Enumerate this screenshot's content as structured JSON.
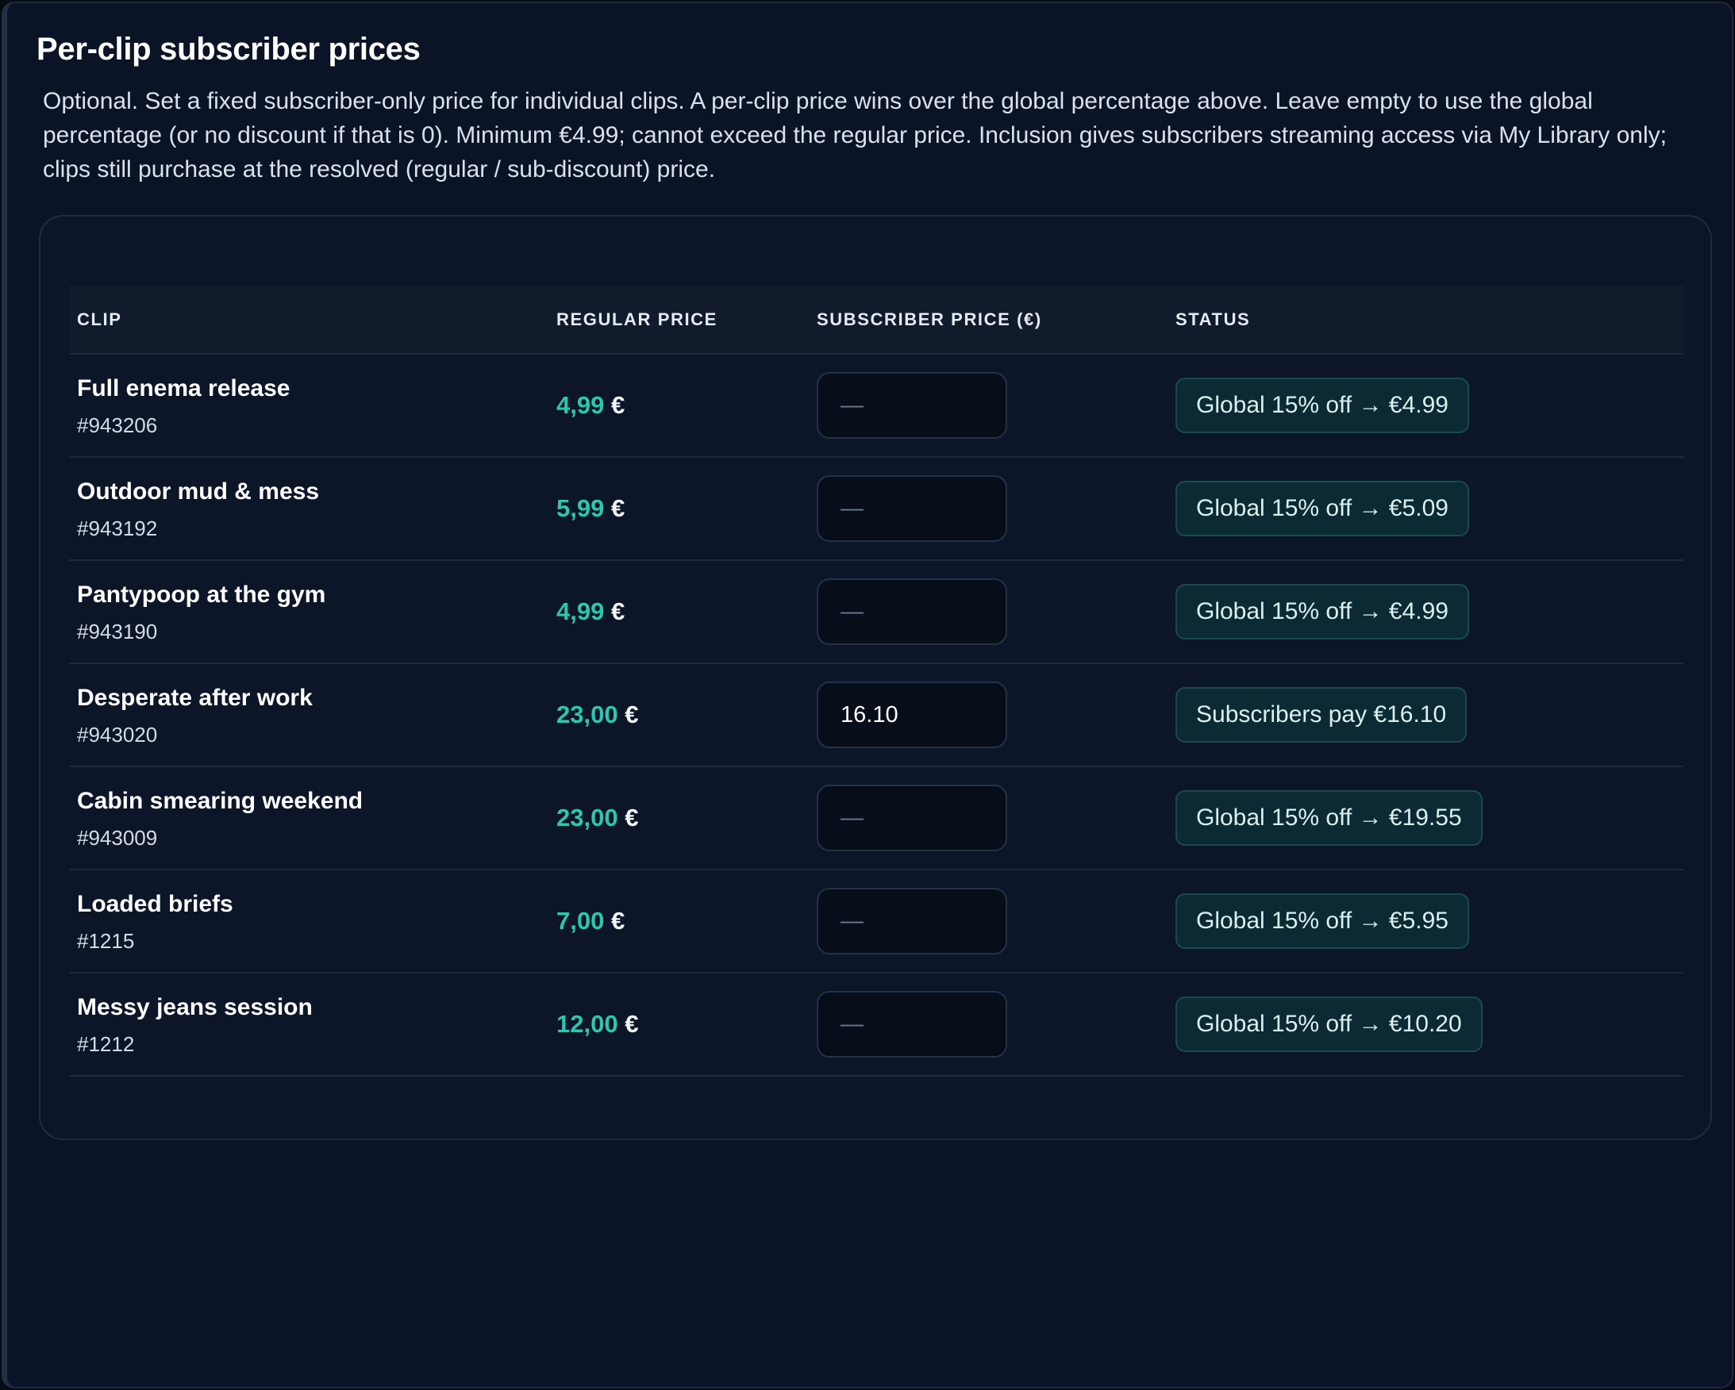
{
  "header": {
    "title": "Per-clip subscriber prices",
    "description": "Optional. Set a fixed subscriber-only price for individual clips. A per-clip price wins over the global percentage above. Leave empty to use the global percentage (or no discount if that is 0). Minimum €4.99; cannot exceed the regular price. Inclusion gives subscribers streaming access via My Library only; clips still purchase at the resolved (regular / sub-discount) price."
  },
  "table": {
    "columns": [
      "CLIP",
      "REGULAR PRICE",
      "SUBSCRIBER PRICE (€)",
      "STATUS"
    ],
    "rows": [
      {
        "name": "Full enema release",
        "id": "#943206",
        "price": "4,99",
        "currency": "€",
        "sub_value": "",
        "sub_placeholder": "—",
        "status": "Global 15% off → €4.99"
      },
      {
        "name": "Outdoor mud & mess",
        "id": "#943192",
        "price": "5,99",
        "currency": "€",
        "sub_value": "",
        "sub_placeholder": "—",
        "status": "Global 15% off → €5.09"
      },
      {
        "name": "Pantypoop at the gym",
        "id": "#943190",
        "price": "4,99",
        "currency": "€",
        "sub_value": "",
        "sub_placeholder": "—",
        "status": "Global 15% off → €4.99"
      },
      {
        "name": "Desperate after work",
        "id": "#943020",
        "price": "23,00",
        "currency": "€",
        "sub_value": "16.10",
        "sub_placeholder": "—",
        "status": "Subscribers pay €16.10"
      },
      {
        "name": "Cabin smearing weekend",
        "id": "#943009",
        "price": "23,00",
        "currency": "€",
        "sub_value": "",
        "sub_placeholder": "—",
        "status": "Global 15% off → €19.55"
      },
      {
        "name": "Loaded briefs",
        "id": "#1215",
        "price": "7,00",
        "currency": "€",
        "sub_value": "",
        "sub_placeholder": "—",
        "status": "Global 15% off → €5.95"
      },
      {
        "name": "Messy jeans session",
        "id": "#1212",
        "price": "12,00",
        "currency": "€",
        "sub_value": "",
        "sub_placeholder": "—",
        "status": "Global 15% off → €10.20"
      }
    ]
  },
  "colors": {
    "background": "#0b1426",
    "accent_price": "#2cc7b0",
    "status_bg": "#0c2a34",
    "status_border": "#174a52"
  }
}
